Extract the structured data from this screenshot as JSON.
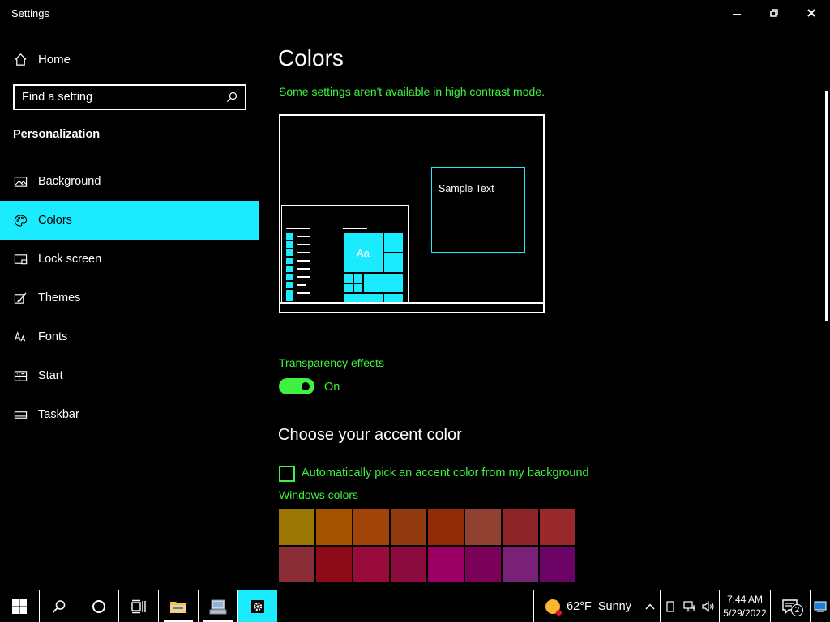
{
  "window": {
    "app_title": "Settings",
    "home_label": "Home",
    "search": {
      "placeholder": "Find a setting"
    },
    "section_title": "Personalization",
    "nav_items": [
      {
        "label": "Background",
        "icon": "picture-icon",
        "selected": false
      },
      {
        "label": "Colors",
        "icon": "palette-icon",
        "selected": true
      },
      {
        "label": "Lock screen",
        "icon": "lock-screen-icon",
        "selected": false
      },
      {
        "label": "Themes",
        "icon": "themes-brush-icon",
        "selected": false
      },
      {
        "label": "Fonts",
        "icon": "fonts-icon",
        "selected": false
      },
      {
        "label": "Start",
        "icon": "start-icon",
        "selected": false
      },
      {
        "label": "Taskbar",
        "icon": "taskbar-icon",
        "selected": false
      }
    ]
  },
  "main": {
    "title": "Colors",
    "hc_note": "Some settings aren't available in high contrast mode.",
    "preview": {
      "sample_text": "Sample Text",
      "tile_label": "Aa"
    },
    "transparency": {
      "label": "Transparency effects",
      "state": "On",
      "enabled": true
    },
    "accent_heading": "Choose your accent color",
    "auto_pick": {
      "label": "Automatically pick an accent color from my background",
      "checked": false
    },
    "windows_colors_label": "Windows colors",
    "swatches": [
      "#9a7705",
      "#a65300",
      "#a2440a",
      "#923a10",
      "#8f2c06",
      "#914132",
      "#8c2428",
      "#99282a",
      "#8b2d36",
      "#8d0a18",
      "#990b3b",
      "#8b0b3e",
      "#9a0063",
      "#7a0058",
      "#792176",
      "#6b0266"
    ]
  },
  "colors": {
    "accent": "#1aebff",
    "hc_text": "#3ff23f",
    "background": "#000000",
    "foreground": "#ffffff"
  },
  "taskbar": {
    "weather": {
      "temp": "62°F",
      "condition": "Sunny"
    },
    "clock": {
      "time": "7:44 AM",
      "date": "5/29/2022"
    },
    "notification_count": "2"
  }
}
